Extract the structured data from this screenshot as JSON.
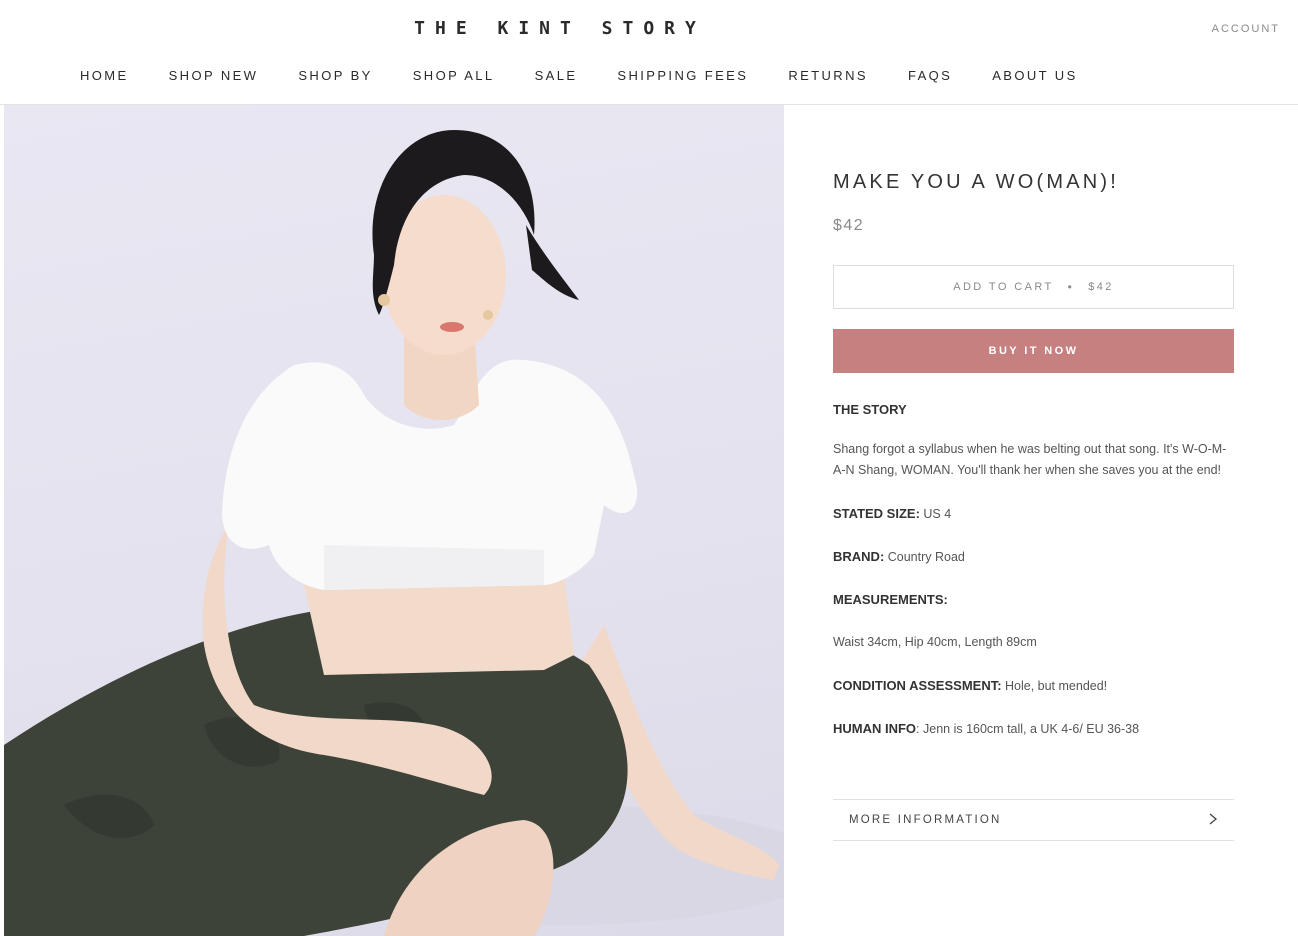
{
  "header": {
    "logo": "THE KINT STORY",
    "account_label": "ACCOUNT",
    "nav": [
      "HOME",
      "SHOP NEW",
      "SHOP BY",
      "SHOP ALL",
      "SALE",
      "SHIPPING FEES",
      "RETURNS",
      "FAQS",
      "ABOUT US"
    ]
  },
  "product": {
    "title": "MAKE YOU A WO(MAN)!",
    "price": "$42",
    "add_to_cart_label": "ADD TO CART",
    "add_to_cart_separator": "•",
    "add_to_cart_price": "$42",
    "buy_now_label": "BUY IT NOW",
    "story_heading": "THE STORY",
    "story_text": "Shang forgot a syllabus when he was belting out that song. It's W-O-M-A-N Shang, WOMAN. You'll thank her when she saves you at the end!",
    "stated_size_label": "STATED SIZE:",
    "stated_size_value": " US 4",
    "brand_label": "BRAND:",
    "brand_value": " Country Road",
    "measurements_label": "MEASUREMENTS:",
    "measurements_value": "Waist 34cm, Hip 40cm, Length 89cm",
    "condition_label": "CONDITION ASSESSMENT:",
    "condition_value": " Hole, but mended!",
    "human_label": "HUMAN INFO",
    "human_value": ": Jenn is 160cm tall, a UK 4-6/ EU 36-38",
    "more_info_label": "MORE INFORMATION",
    "more_info_icon": "chevron-right-icon"
  },
  "colors": {
    "buy_button": "#c78080",
    "background": "#ffffff",
    "photo_backdrop": "#e6e4f0",
    "skirt": "#3d4339"
  }
}
